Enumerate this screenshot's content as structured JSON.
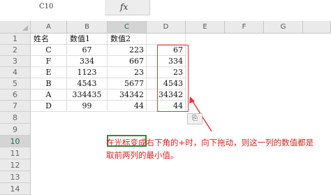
{
  "formula_bar": {
    "name_box": "C10",
    "fx_label": "fx"
  },
  "columns": [
    "A",
    "B",
    "C",
    "D",
    "E",
    "F",
    "G"
  ],
  "rows": [
    "1",
    "2",
    "3",
    "4",
    "5",
    "6",
    "7",
    "8",
    "9",
    "10",
    "11",
    "12",
    "13",
    "14"
  ],
  "table": {
    "headers": [
      "姓名",
      "数值1",
      "数值2"
    ],
    "rows": [
      [
        "C",
        "67",
        "223",
        "67"
      ],
      [
        "F",
        "334",
        "667",
        "334"
      ],
      [
        "E",
        "1123",
        "23",
        "23"
      ],
      [
        "B",
        "4543",
        "5677",
        "4543"
      ],
      [
        "A",
        "334435",
        "34342",
        "34342"
      ],
      [
        "D",
        "99",
        "44",
        "44"
      ]
    ]
  },
  "paste_options_icon": "paste-options-icon",
  "annotation": "在光标变成右下角的+时，向下拖动，则这一列的数值都是取前两列的最小值。",
  "colors": {
    "highlight_box": "#e33333",
    "selection": "#2f8a3e",
    "annotation_text": "#e12020"
  }
}
